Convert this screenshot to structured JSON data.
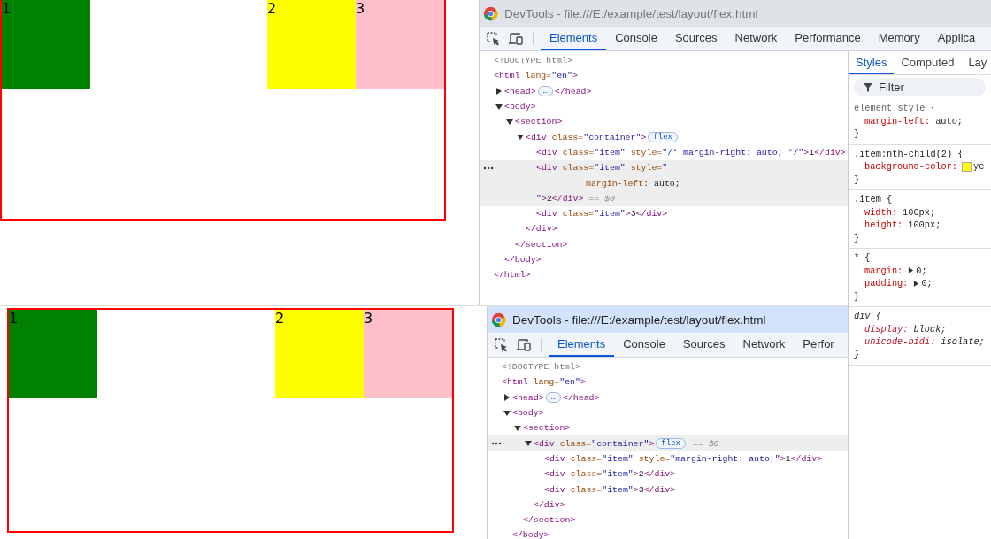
{
  "screens": [
    {
      "preview": {
        "items": [
          {
            "label": "1",
            "color": "#008000"
          },
          {
            "label": "2",
            "color": "#ffff00"
          },
          {
            "label": "3",
            "color": "#ffc0cb"
          }
        ]
      },
      "devtools": {
        "title": "DevTools - file:///E:/example/test/layout/flex.html",
        "focused": false,
        "tabs": [
          {
            "label": "Elements",
            "selected": true
          },
          {
            "label": "Console",
            "selected": false
          },
          {
            "label": "Sources",
            "selected": false
          },
          {
            "label": "Network",
            "selected": false
          },
          {
            "label": "Performance",
            "selected": false
          },
          {
            "label": "Memory",
            "selected": false
          },
          {
            "label": "Applica",
            "selected": false
          }
        ],
        "tree": [
          {
            "selected": false,
            "lines": [
              [
                {
                  "kind": "doctype",
                  "text": "<!DOCTYPE html>"
                }
              ]
            ]
          },
          {
            "selected": false,
            "lines": [
              [
                {
                  "kind": "tag",
                  "text": "<html"
                },
                {
                  "kind": "attr",
                  "text": " lang="
                },
                {
                  "kind": "value",
                  "text": "\"en\""
                },
                {
                  "kind": "tag",
                  "text": ">"
                }
              ]
            ],
            "close": [
              {
                "kind": "tag",
                "text": "</html>"
              }
            ],
            "children": [
              {
                "selected": false,
                "expanded": false,
                "lines": [
                  [
                    {
                      "kind": "tag",
                      "text": "<head>"
                    },
                    {
                      "kind": "pill",
                      "text": "…"
                    },
                    {
                      "kind": "tag",
                      "text": "</head>"
                    }
                  ]
                ]
              },
              {
                "selected": false,
                "expanded": true,
                "lines": [
                  [
                    {
                      "kind": "tag",
                      "text": "<body>"
                    }
                  ]
                ],
                "close": [
                  {
                    "kind": "tag",
                    "text": "</body>"
                  }
                ],
                "children": [
                  {
                    "selected": false,
                    "expanded": true,
                    "lines": [
                      [
                        {
                          "kind": "tag",
                          "text": "<section>"
                        }
                      ]
                    ],
                    "close": [
                      {
                        "kind": "tag",
                        "text": "</section>"
                      }
                    ],
                    "children": [
                      {
                        "selected": false,
                        "expanded": true,
                        "lines": [
                          [
                            {
                              "kind": "tag",
                              "text": "<div"
                            },
                            {
                              "kind": "attr",
                              "text": " class="
                            },
                            {
                              "kind": "value",
                              "text": "\"container\""
                            },
                            {
                              "kind": "tag",
                              "text": ">"
                            },
                            {
                              "kind": "pill",
                              "text": "flex"
                            }
                          ]
                        ],
                        "close": [
                          {
                            "kind": "tag",
                            "text": "</div>"
                          }
                        ],
                        "children": [
                          {
                            "selected": false,
                            "lines": [
                              [
                                {
                                  "kind": "tag",
                                  "text": "<div"
                                },
                                {
                                  "kind": "attr",
                                  "text": " class="
                                },
                                {
                                  "kind": "value",
                                  "text": "\"item\""
                                },
                                {
                                  "kind": "attr",
                                  "text": " style="
                                },
                                {
                                  "kind": "value",
                                  "text": "\"/* margin-right: auto; */\""
                                },
                                {
                                  "kind": "tag",
                                  "text": ">"
                                },
                                {
                                  "kind": "text",
                                  "text": "1"
                                },
                                {
                                  "kind": "tag",
                                  "text": "</div>"
                                }
                              ]
                            ]
                          },
                          {
                            "selected": true,
                            "lines": [
                              [
                                {
                                  "kind": "tag",
                                  "text": "<div"
                                },
                                {
                                  "kind": "attr",
                                  "text": " class="
                                },
                                {
                                  "kind": "value",
                                  "text": "\"item\""
                                },
                                {
                                  "kind": "attr",
                                  "text": " style="
                                },
                                {
                                  "kind": "value",
                                  "text": "\""
                                }
                              ],
                              [
                                {
                                  "kind": "attr",
                                  "text": "margin-left"
                                },
                                {
                                  "kind": "text",
                                  "text": ": auto;"
                                }
                              ],
                              [
                                {
                                  "kind": "value",
                                  "text": "\""
                                },
                                {
                                  "kind": "tag",
                                  "text": ">"
                                },
                                {
                                  "kind": "text",
                                  "text": "2"
                                },
                                {
                                  "kind": "tag",
                                  "text": "</div>"
                                },
                                {
                                  "kind": "ref",
                                  "text": " == $0"
                                }
                              ]
                            ]
                          },
                          {
                            "selected": false,
                            "lines": [
                              [
                                {
                                  "kind": "tag",
                                  "text": "<div"
                                },
                                {
                                  "kind": "attr",
                                  "text": " class="
                                },
                                {
                                  "kind": "value",
                                  "text": "\"item\""
                                },
                                {
                                  "kind": "tag",
                                  "text": ">"
                                },
                                {
                                  "kind": "text",
                                  "text": "3"
                                },
                                {
                                  "kind": "tag",
                                  "text": "</div>"
                                }
                              ]
                            ]
                          }
                        ]
                      }
                    ]
                  }
                ]
              }
            ]
          }
        ],
        "styles": {
          "tabs": [
            {
              "label": "Styles",
              "selected": true
            },
            {
              "label": "Computed",
              "selected": false
            },
            {
              "label": "Lay",
              "selected": false
            }
          ],
          "filter": {
            "placeholder": "Filter"
          },
          "rules": [
            {
              "kind": "inline",
              "selector": "element.style {",
              "close": "}",
              "declarations": [
                {
                  "name": "margin-left:",
                  "value": "auto;"
                }
              ]
            },
            {
              "kind": "author",
              "selector": ".item:nth-child(2) {",
              "close": "}",
              "declarations": [
                {
                  "name": "background-color:",
                  "value": "ye",
                  "color": "#ffff00"
                }
              ]
            },
            {
              "kind": "author",
              "selector": ".item {",
              "close": "}",
              "declarations": [
                {
                  "name": "width:",
                  "value": "100px;"
                },
                {
                  "name": "height:",
                  "value": "100px;"
                }
              ]
            },
            {
              "kind": "author",
              "selector": "* {",
              "close": "}",
              "declarations": [
                {
                  "name": "margin:",
                  "value": "0;",
                  "expandable": true
                },
                {
                  "name": "padding:",
                  "value": "0;",
                  "expandable": true
                }
              ]
            },
            {
              "kind": "useragent",
              "selector": "div {",
              "close": "}",
              "declarations": [
                {
                  "name": "display:",
                  "value": "block;"
                },
                {
                  "name": "unicode-bidi:",
                  "value": "isolate;"
                }
              ]
            }
          ]
        }
      }
    },
    {
      "preview": {
        "items": [
          {
            "label": "1",
            "color": "#008000"
          },
          {
            "label": "2",
            "color": "#ffff00"
          },
          {
            "label": "3",
            "color": "#ffc0cb"
          }
        ]
      },
      "devtools": {
        "title": "DevTools - file:///E:/example/test/layout/flex.html",
        "focused": true,
        "tabs": [
          {
            "label": "Elements",
            "selected": true
          },
          {
            "label": "Console",
            "selected": false
          },
          {
            "label": "Sources",
            "selected": false
          },
          {
            "label": "Network",
            "selected": false
          },
          {
            "label": "Perfor",
            "selected": false
          }
        ],
        "tree": [
          {
            "selected": false,
            "lines": [
              [
                {
                  "kind": "doctype",
                  "text": "<!DOCTYPE html>"
                }
              ]
            ]
          },
          {
            "selected": false,
            "lines": [
              [
                {
                  "kind": "tag",
                  "text": "<html"
                },
                {
                  "kind": "attr",
                  "text": " lang="
                },
                {
                  "kind": "value",
                  "text": "\"en\""
                },
                {
                  "kind": "tag",
                  "text": ">"
                }
              ]
            ],
            "children": [
              {
                "selected": false,
                "expanded": false,
                "lines": [
                  [
                    {
                      "kind": "tag",
                      "text": "<head>"
                    },
                    {
                      "kind": "pill",
                      "text": "…"
                    },
                    {
                      "kind": "tag",
                      "text": "</head>"
                    }
                  ]
                ]
              },
              {
                "selected": false,
                "expanded": true,
                "lines": [
                  [
                    {
                      "kind": "tag",
                      "text": "<body>"
                    }
                  ]
                ],
                "close": [
                  {
                    "kind": "tag",
                    "text": "</body>"
                  }
                ],
                "children": [
                  {
                    "selected": false,
                    "expanded": true,
                    "lines": [
                      [
                        {
                          "kind": "tag",
                          "text": "<section>"
                        }
                      ]
                    ],
                    "close": [
                      {
                        "kind": "tag",
                        "text": "</section>"
                      }
                    ],
                    "children": [
                      {
                        "selected": true,
                        "expanded": true,
                        "lines": [
                          [
                            {
                              "kind": "tag",
                              "text": "<div"
                            },
                            {
                              "kind": "attr",
                              "text": " class="
                            },
                            {
                              "kind": "value",
                              "text": "\"container\""
                            },
                            {
                              "kind": "tag",
                              "text": ">"
                            },
                            {
                              "kind": "pill",
                              "text": "flex"
                            },
                            {
                              "kind": "ref",
                              "text": " == $0"
                            }
                          ]
                        ],
                        "close": [
                          {
                            "kind": "tag",
                            "text": "</div>"
                          }
                        ],
                        "children": [
                          {
                            "selected": false,
                            "lines": [
                              [
                                {
                                  "kind": "tag",
                                  "text": "<div"
                                },
                                {
                                  "kind": "attr",
                                  "text": " class="
                                },
                                {
                                  "kind": "value",
                                  "text": "\"item\""
                                },
                                {
                                  "kind": "attr",
                                  "text": " style="
                                },
                                {
                                  "kind": "value",
                                  "text": "\"margin-right: auto;\""
                                },
                                {
                                  "kind": "tag",
                                  "text": ">"
                                },
                                {
                                  "kind": "text",
                                  "text": "1"
                                },
                                {
                                  "kind": "tag",
                                  "text": "</div>"
                                }
                              ]
                            ]
                          },
                          {
                            "selected": false,
                            "lines": [
                              [
                                {
                                  "kind": "tag",
                                  "text": "<div"
                                },
                                {
                                  "kind": "attr",
                                  "text": " class="
                                },
                                {
                                  "kind": "value",
                                  "text": "\"item\""
                                },
                                {
                                  "kind": "tag",
                                  "text": ">"
                                },
                                {
                                  "kind": "text",
                                  "text": "2"
                                },
                                {
                                  "kind": "tag",
                                  "text": "</div>"
                                }
                              ]
                            ]
                          },
                          {
                            "selected": false,
                            "lines": [
                              [
                                {
                                  "kind": "tag",
                                  "text": "<div"
                                },
                                {
                                  "kind": "attr",
                                  "text": " class="
                                },
                                {
                                  "kind": "value",
                                  "text": "\"item\""
                                },
                                {
                                  "kind": "tag",
                                  "text": ">"
                                },
                                {
                                  "kind": "text",
                                  "text": "3"
                                },
                                {
                                  "kind": "tag",
                                  "text": "</div>"
                                }
                              ]
                            ]
                          }
                        ]
                      }
                    ]
                  }
                ]
              }
            ]
          }
        ]
      }
    }
  ]
}
